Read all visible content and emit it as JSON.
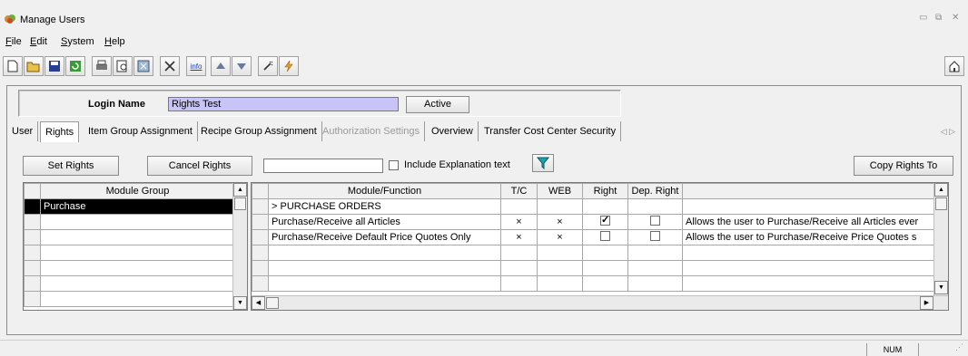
{
  "window": {
    "title": "Manage Users"
  },
  "menu": [
    {
      "accel": "F",
      "rest": "ile"
    },
    {
      "accel": "E",
      "rest": "dit"
    },
    {
      "accel": "S",
      "rest": "ystem"
    },
    {
      "accel": "H",
      "rest": "elp"
    }
  ],
  "toolbar_icons": [
    "new-icon",
    "open-icon",
    "save-icon",
    "refresh-icon",
    "print-icon",
    "print-preview-icon",
    "export-icon",
    "delete-icon",
    "info-icon",
    "up-arrow-icon",
    "down-arrow-icon",
    "wand-icon",
    "lightning-icon",
    "home-icon"
  ],
  "login": {
    "label": "Login Name",
    "value": "Rights Test",
    "status_button": "Active"
  },
  "tabs": [
    {
      "label": "User",
      "state": "normal"
    },
    {
      "label": "Rights",
      "state": "selected"
    },
    {
      "label": "Item Group Assignment",
      "state": "normal"
    },
    {
      "label": "Recipe Group Assignment",
      "state": "normal"
    },
    {
      "label": "Authorization Settings",
      "state": "disabled"
    },
    {
      "label": "Overview",
      "state": "normal"
    },
    {
      "label": "Transfer Cost Center Security",
      "state": "normal"
    }
  ],
  "actions": {
    "set_rights": "Set Rights",
    "cancel_rights": "Cancel Rights",
    "search_value": "",
    "include_explanation": "Include Explanation text",
    "copy_rights": "Copy Rights To"
  },
  "module_grid": {
    "header": "Module Group",
    "rows": [
      "Purchase",
      "",
      "",
      "",
      "",
      "",
      ""
    ]
  },
  "function_grid": {
    "headers": [
      "Module/Function",
      "T/C",
      "WEB",
      "Right",
      "Dep. Right",
      ""
    ],
    "rows": [
      {
        "name": "> PURCHASE ORDERS",
        "tc": "",
        "web": "",
        "right": null,
        "dep": null,
        "desc": ""
      },
      {
        "name": "Purchase/Receive all Articles",
        "tc": "×",
        "web": "×",
        "right": true,
        "dep": false,
        "desc": "Allows the user to Purchase/Receive all Articles ever"
      },
      {
        "name": "Purchase/Receive Default Price Quotes Only",
        "tc": "×",
        "web": "×",
        "right": false,
        "dep": false,
        "desc": "Allows the user to Purchase/Receive Price Quotes s"
      },
      {
        "name": "",
        "tc": "",
        "web": "",
        "right": null,
        "dep": null,
        "desc": ""
      },
      {
        "name": "",
        "tc": "",
        "web": "",
        "right": null,
        "dep": null,
        "desc": ""
      },
      {
        "name": "",
        "tc": "",
        "web": "",
        "right": null,
        "dep": null,
        "desc": ""
      }
    ]
  },
  "status": {
    "num": "NUM"
  }
}
